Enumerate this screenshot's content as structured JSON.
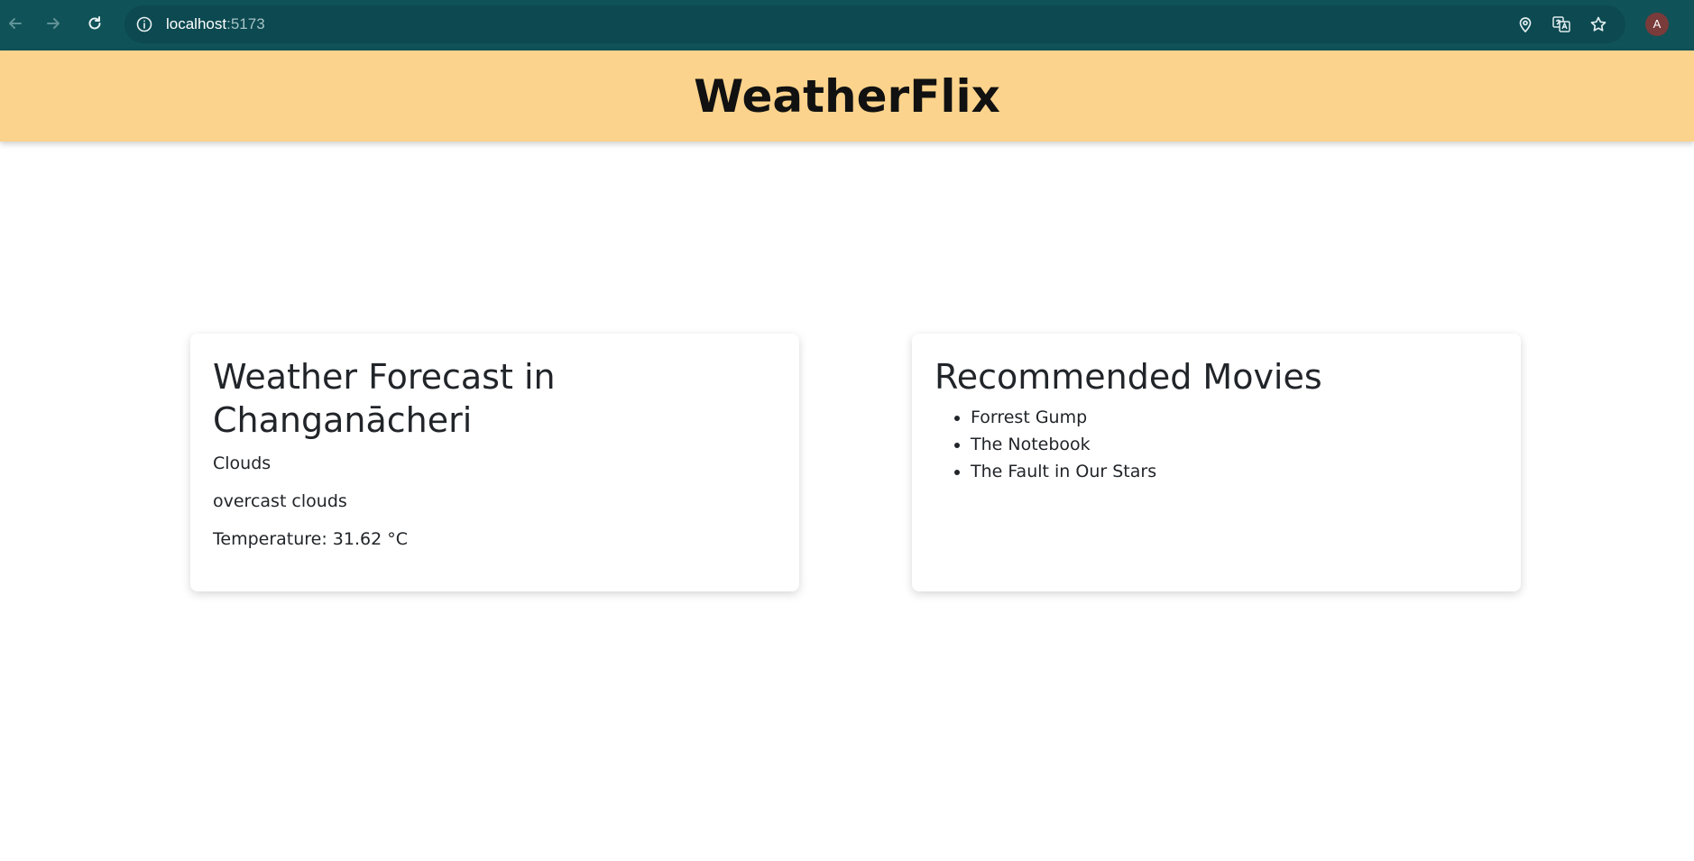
{
  "browser": {
    "url_host": "localhost",
    "url_port": ":5173",
    "avatar_initial": "A",
    "icons": {
      "back": "back-arrow-icon",
      "forward": "forward-arrow-icon",
      "reload": "reload-icon",
      "site_info": "info-icon",
      "location": "location-pin-icon",
      "translate": "translate-icon",
      "bookmark": "star-icon"
    }
  },
  "header": {
    "title": "WeatherFlix",
    "background": "#fcd38c"
  },
  "weather": {
    "heading": "Weather Forecast in Changanācheri",
    "condition": "Clouds",
    "description": "overcast clouds",
    "temperature": "Temperature: 31.62 °C"
  },
  "movies": {
    "heading": "Recommended Movies",
    "items": [
      "Forrest Gump",
      "The Notebook",
      "The Fault in Our Stars"
    ]
  },
  "colors": {
    "chrome": "#0f5257",
    "omnibox": "#0c4950",
    "text": "#212529"
  }
}
